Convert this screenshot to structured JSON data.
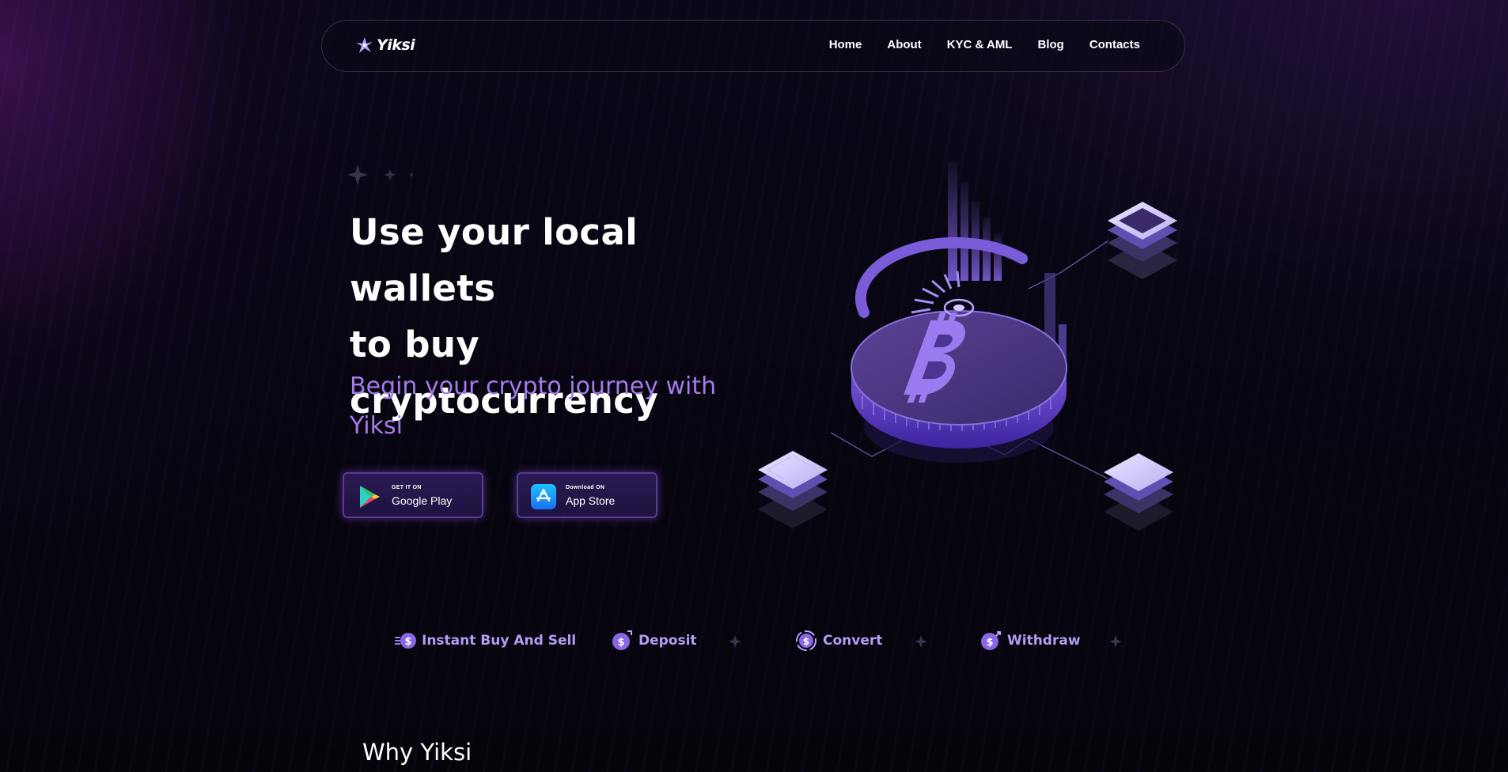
{
  "brand": {
    "name": "Yiksi",
    "accent": "#a47be8",
    "background": "#06040d"
  },
  "nav": {
    "items": [
      {
        "label": "Home"
      },
      {
        "label": "About"
      },
      {
        "label": "KYC & AML"
      },
      {
        "label": "Blog"
      },
      {
        "label": "Contacts"
      }
    ]
  },
  "hero": {
    "title_lines": [
      "Use your local wallets",
      "to buy",
      "cryptocurrency"
    ],
    "subtitle_lines": [
      "Begin your crypto journey with",
      "Yiksi"
    ],
    "buttons": {
      "google": {
        "small": "GET IT ON",
        "big": "Google Play",
        "icon": "google-play-icon"
      },
      "apple": {
        "small": "Download ON",
        "big": "App Store",
        "icon": "app-store-icon"
      }
    },
    "illustration": "bitcoin-coin-illustration"
  },
  "features": [
    {
      "label": "Instant Buy And Sell",
      "icon": "dollar-coin-arrows-icon"
    },
    {
      "label": "Deposit",
      "icon": "dollar-coin-deposit-icon"
    },
    {
      "label": "Convert",
      "icon": "dollar-coin-convert-icon"
    },
    {
      "label": "Withdraw",
      "icon": "dollar-coin-withdraw-icon"
    }
  ],
  "why": {
    "heading": "Why Yiksi"
  }
}
